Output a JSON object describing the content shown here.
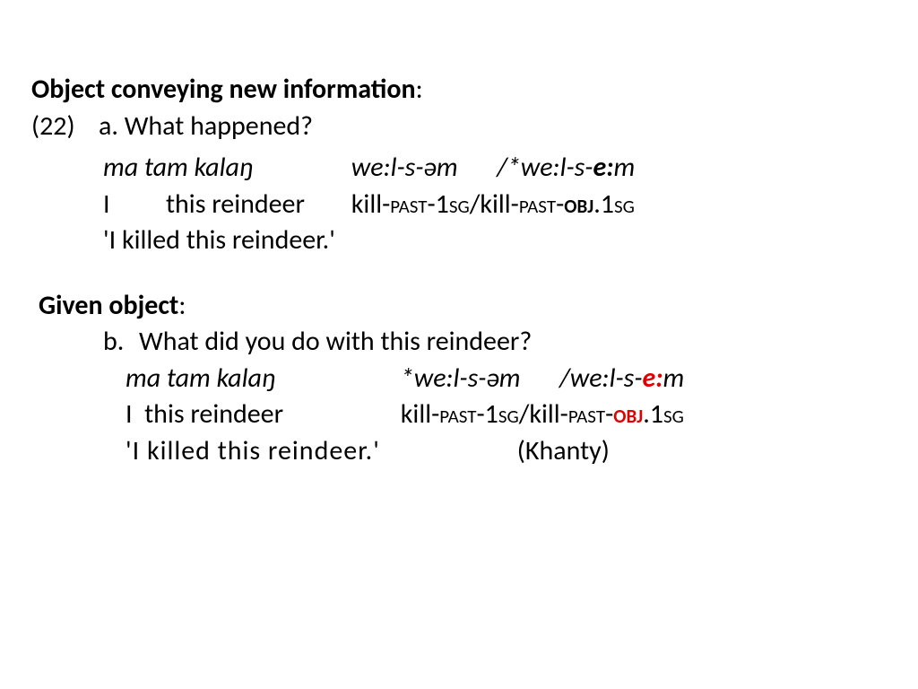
{
  "header1": {
    "bold": "Object conveying new information",
    "colon": ":"
  },
  "exnum": "(22)",
  "a_letter": "a.",
  "a_question": " What happened?",
  "a_src_col1": "ma tam kalaŋ",
  "a_src_form1": "we:l-s-əm",
  "a_src_sep": "/*",
  "a_src_form2a": "we:l-s-",
  "a_src_form2b": "e:",
  "a_src_form2c": "m",
  "a_gl_I": "I",
  "a_gl_this_reindeer": "this reindeer",
  "a_gl_kill1": "kill-",
  "a_gl_past": "past",
  "a_gl_dash": "-1",
  "a_gl_sg": "sg",
  "a_gl_slash": "/",
  "a_gl_kill2": "kill-",
  "a_gl_past2": "past",
  "a_gl_dash2": "-",
  "a_gl_obj": "obj",
  "a_gl_dot1": ".1",
  "a_gl_sg2": "sg",
  "a_trans": "'I killed this reindeer.'",
  "header2": {
    "bold": "Given object",
    "colon": ":"
  },
  "b_letter": "b.",
  "b_question": "What did you do with this reindeer?",
  "b_src_col1": "ma tam kalaŋ",
  "b_src_star": "*",
  "b_src_form1": "we:l-s-əm",
  "b_src_sep": "/",
  "b_src_form2a": "we:l-s-",
  "b_src_form2b": "e:",
  "b_src_form2c": "m",
  "b_gl_I": "I",
  "b_gl_this_reindeer": "  this reindeer",
  "b_gl_kill1": "kill-",
  "b_gl_past": "past",
  "b_gl_dash": "-1",
  "b_gl_sg": "sg",
  "b_gl_slash": "/",
  "b_gl_kill2": "kill-",
  "b_gl_past2": "past",
  "b_gl_dash2": "-",
  "b_gl_obj": "obj",
  "b_gl_dot1": ".1",
  "b_gl_sg2": "sg",
  "b_trans": "'I killed this reindeer.'",
  "b_lang": "(Khanty)"
}
